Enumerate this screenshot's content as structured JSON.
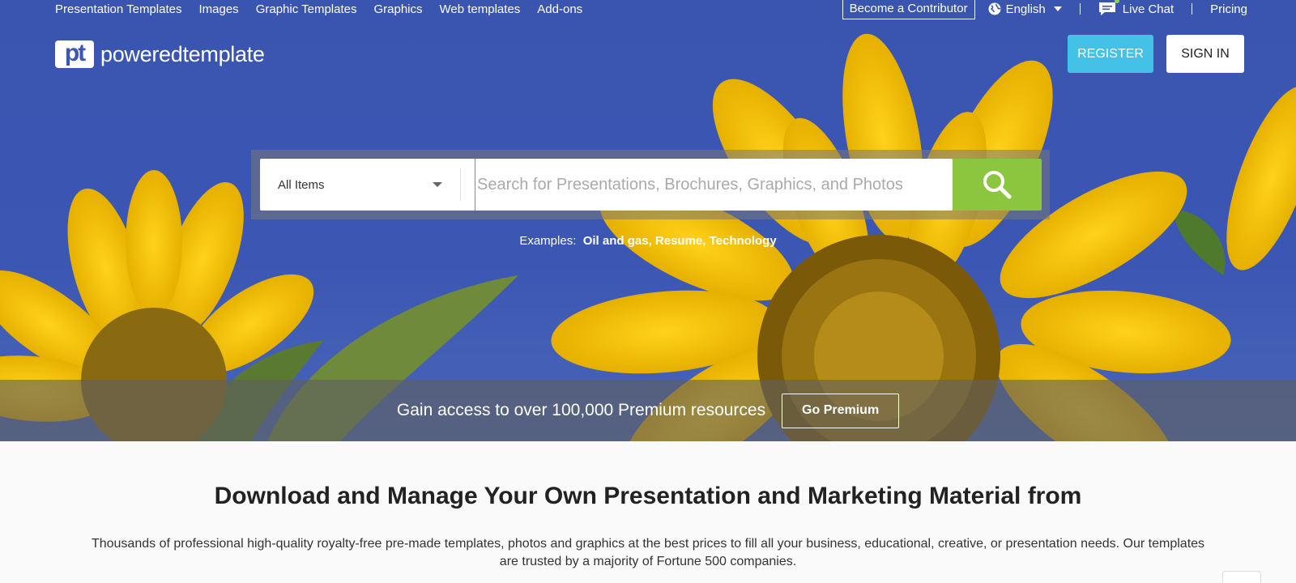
{
  "nav": {
    "items": [
      "Presentation Templates",
      "Images",
      "Graphic Templates",
      "Graphics",
      "Web templates",
      "Add-ons"
    ],
    "contributor": "Become a Contributor",
    "language": "English",
    "live_chat": "Live Chat",
    "pricing": "Pricing"
  },
  "brand": {
    "logo_mark": "pt",
    "name": "poweredtemplate"
  },
  "auth": {
    "register": "REGISTER",
    "signin": "SIGN IN"
  },
  "search": {
    "category": "All Items",
    "placeholder": "Search for Presentations, Brochures, Graphics, and Photos",
    "examples_label": "Examples:",
    "examples": [
      "Oil and gas",
      "Resume",
      "Technology"
    ]
  },
  "premium": {
    "text": "Gain access to over 100,000 Premium resources",
    "button": "Go Premium"
  },
  "main": {
    "heading": "Download and Manage Your Own Presentation and Marketing Material from",
    "description": "Thousands of professional high-quality royalty-free pre-made templates, photos and graphics at the best prices to fill all your business, educational, creative, or presentation needs. Our templates are trusted by a majority of Fortune 500 companies."
  },
  "colors": {
    "hero_blue": "#3b57b3",
    "register": "#44c1e6",
    "search_button": "#8cc63f",
    "sunflower": "#f2c414"
  },
  "icons": {
    "language": "globe-icon",
    "chat": "chat-bubble-icon",
    "search": "magnifier-icon"
  }
}
